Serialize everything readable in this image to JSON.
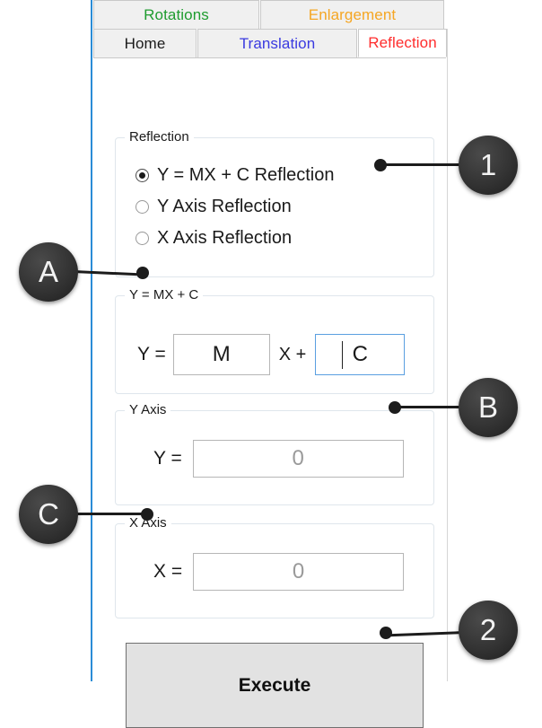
{
  "window": {
    "accent_left_border": "#2a8cd6"
  },
  "tabs": {
    "top_row": [
      {
        "label": "Rotations",
        "color": "#1f9c2f",
        "selected": false
      },
      {
        "label": "Enlargement",
        "color": "#f5a623",
        "selected": false
      }
    ],
    "bottom_row": [
      {
        "label": "Home",
        "color": "#1a1a1a",
        "selected": false
      },
      {
        "label": "Translation",
        "color": "#3a3ae0",
        "selected": false
      },
      {
        "label": "Reflection",
        "color": "#ff2d2d",
        "selected": true
      }
    ]
  },
  "reflection_group": {
    "legend": "Reflection",
    "options": [
      {
        "label": "Y = MX + C Reflection",
        "checked": true
      },
      {
        "label": "Y Axis Reflection",
        "checked": false
      },
      {
        "label": "X Axis Reflection",
        "checked": false
      }
    ]
  },
  "mxc_group": {
    "legend": "Y = MX + C",
    "y_equals_label": "Y =",
    "m_value": "M",
    "x_plus_label": "X +",
    "c_value": "C",
    "c_focused": true,
    "focus_color": "#5a9fe0"
  },
  "yaxis_group": {
    "legend": "Y Axis",
    "y_equals_label": "Y =",
    "value": "0"
  },
  "xaxis_group": {
    "legend": "X Axis",
    "x_equals_label": "X =",
    "value": "0"
  },
  "execute": {
    "label": "Execute"
  },
  "callouts": {
    "one": "1",
    "a": "A",
    "b": "B",
    "c": "C",
    "two": "2"
  }
}
